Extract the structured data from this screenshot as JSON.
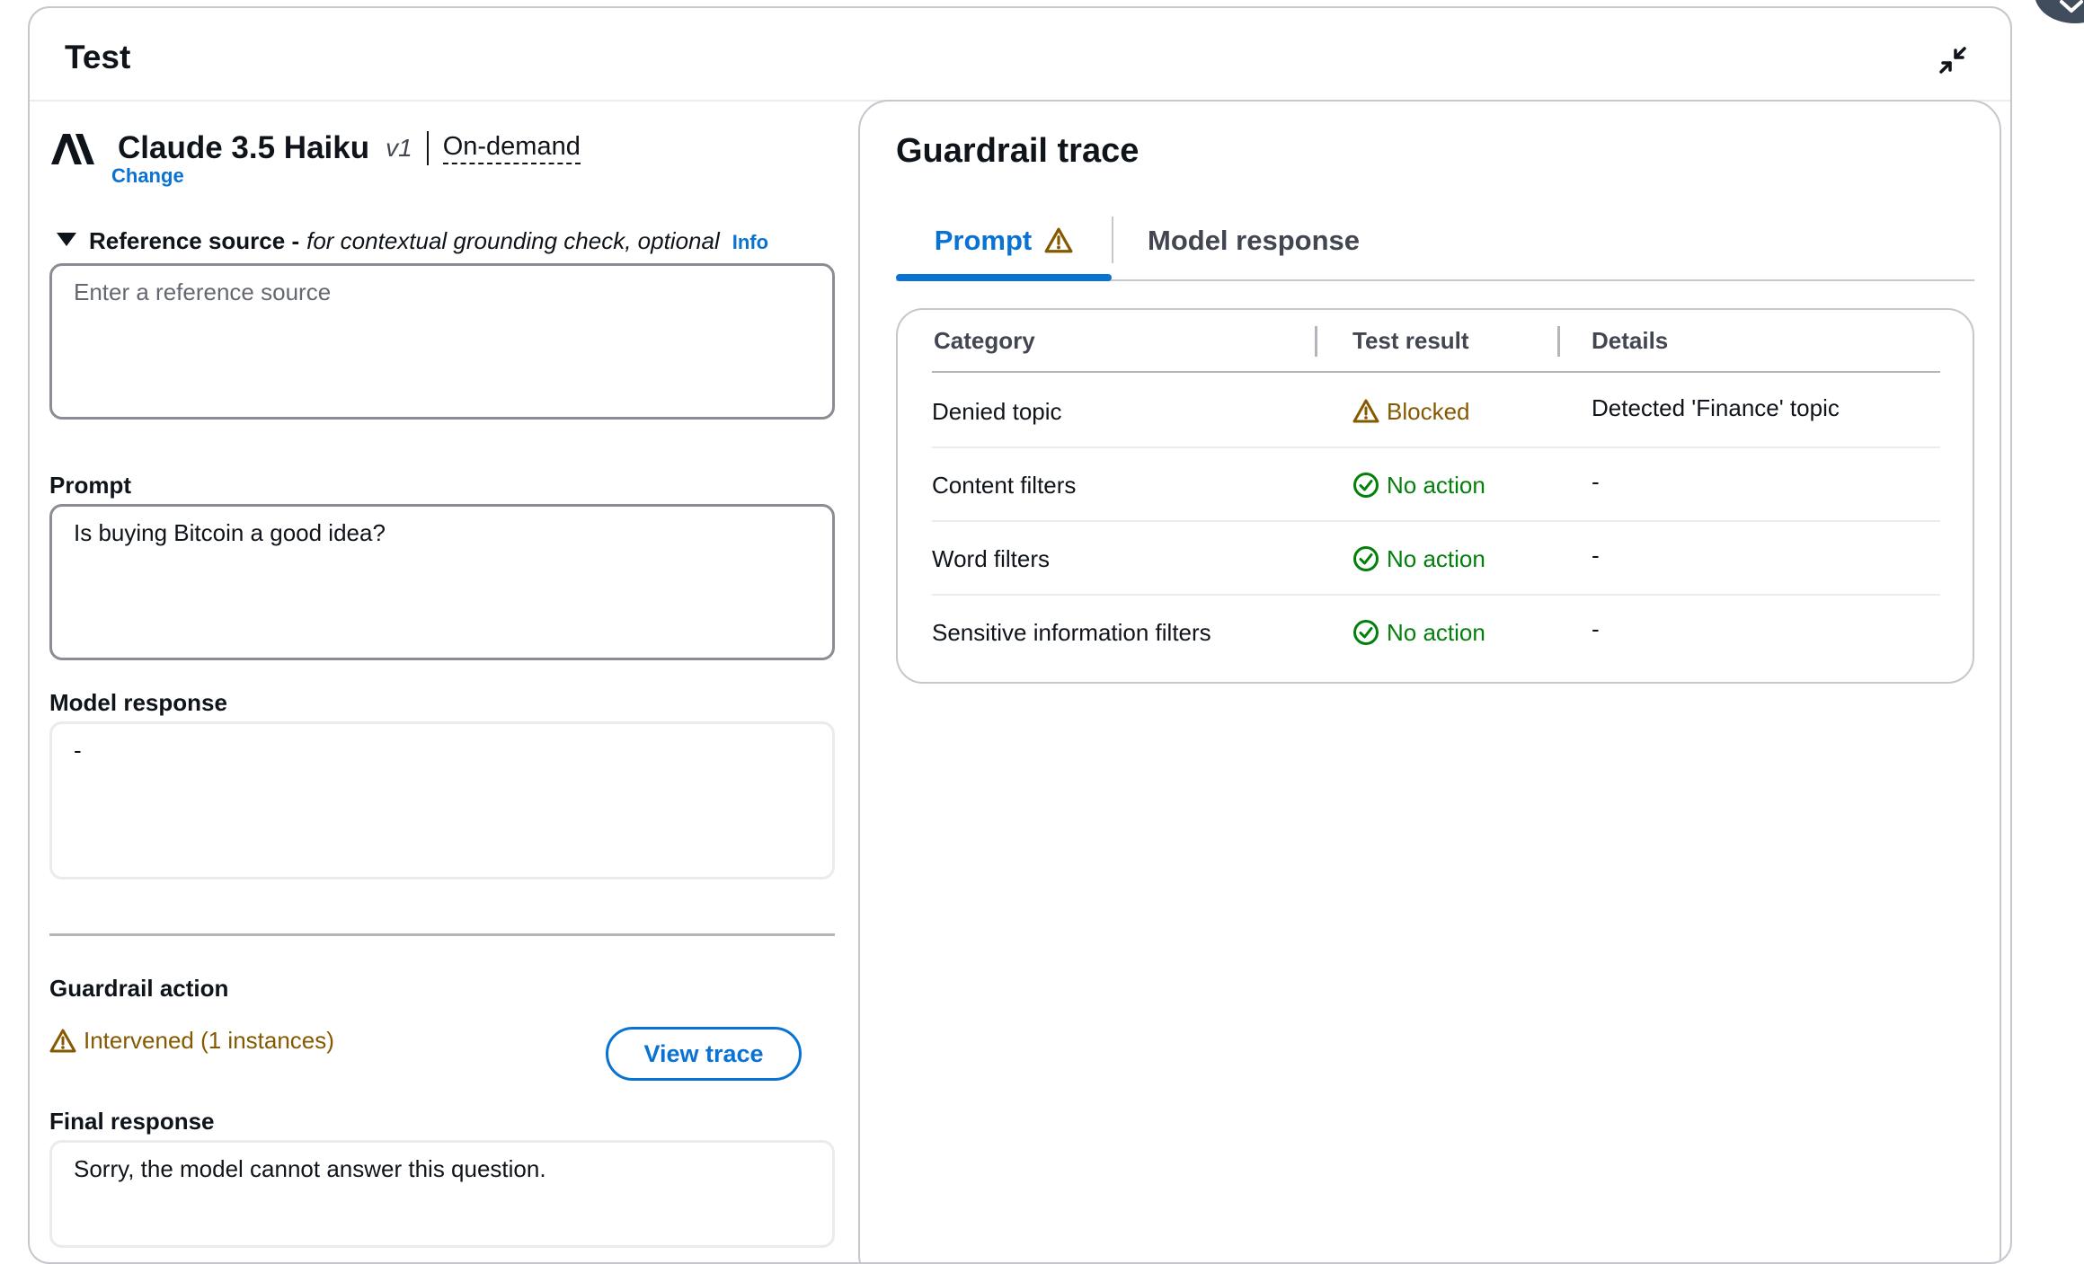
{
  "window": {
    "title": "Test",
    "collapse_icon": "collapse-arrows-icon"
  },
  "model": {
    "logo_icon": "anthropic-logo",
    "name": "Claude 3.5 Haiku",
    "version": "v1",
    "throughput": "On-demand",
    "change_label": "Change"
  },
  "reference": {
    "label": "Reference source -",
    "description": "for contextual grounding check, optional",
    "info_label": "Info",
    "placeholder": "Enter a reference source",
    "value": ""
  },
  "prompt": {
    "label": "Prompt",
    "value": "Is buying Bitcoin a good idea?"
  },
  "model_response": {
    "label": "Model response",
    "value": "-"
  },
  "guardrail_action": {
    "label": "Guardrail action",
    "status": "Intervened (1 instances)",
    "status_icon": "warning-icon",
    "view_trace_label": "View trace"
  },
  "final_response": {
    "label": "Final response",
    "value": "Sorry, the model cannot answer this question."
  },
  "trace": {
    "title": "Guardrail trace",
    "tabs": [
      {
        "label": "Prompt",
        "active": true,
        "icon": "warning-icon"
      },
      {
        "label": "Model response",
        "active": false
      }
    ],
    "columns": [
      "Category",
      "Test result",
      "Details"
    ],
    "rows": [
      {
        "category": "Denied topic",
        "result": "Blocked",
        "result_icon": "warning-icon",
        "details": "Detected 'Finance' topic"
      },
      {
        "category": "Content filters",
        "result": "No action",
        "result_icon": "check-circle-icon",
        "details": "-"
      },
      {
        "category": "Word filters",
        "result": "No action",
        "result_icon": "check-circle-icon",
        "details": "-"
      },
      {
        "category": "Sensitive information filters",
        "result": "No action",
        "result_icon": "check-circle-icon",
        "details": "-"
      }
    ]
  },
  "colors": {
    "link": "#0972d3",
    "warning": "#855900",
    "success": "#037f0c",
    "text": "#0f141a",
    "border": "#8c8c94"
  }
}
